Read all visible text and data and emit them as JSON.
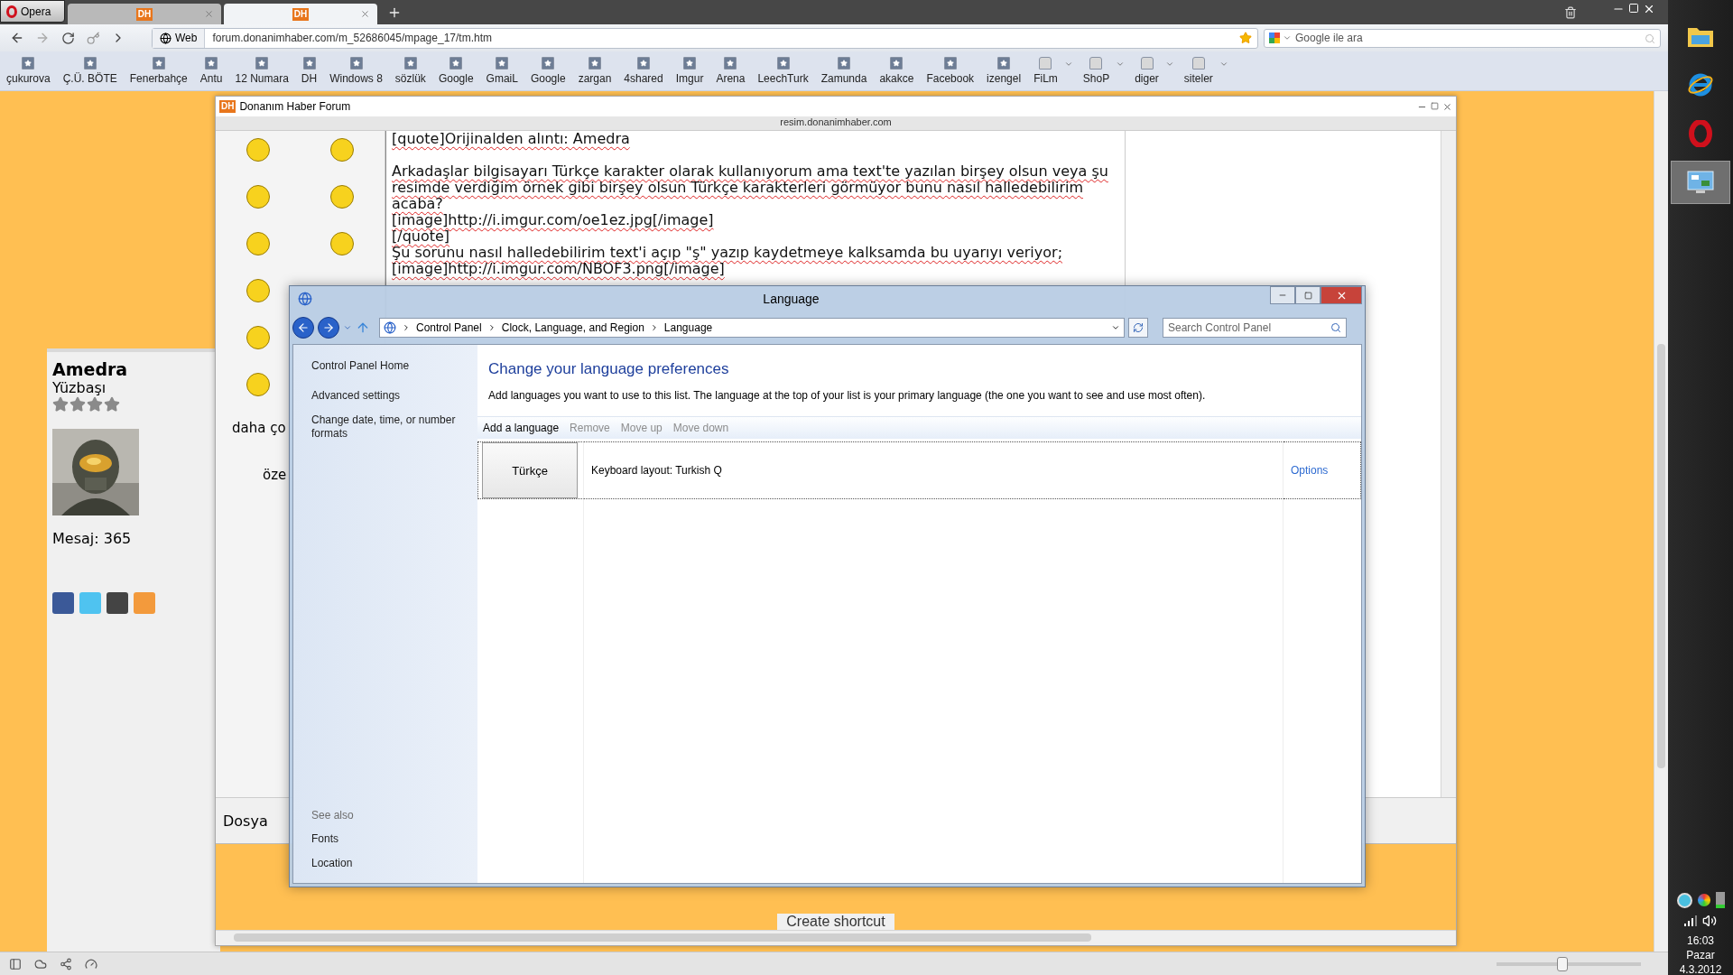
{
  "browser": {
    "menu_button": "Opera",
    "tabs": [
      {
        "logo": "DH",
        "selected": false
      },
      {
        "logo": "DH",
        "selected": true
      }
    ],
    "address": {
      "scheme": "Web",
      "url": "forum.donanimhaber.com/m_52686045/mpage_17/tm.htm"
    },
    "search": {
      "placeholder": "Google ile ara"
    },
    "bookmarks": [
      {
        "label": "çukurova",
        "kind": "site"
      },
      {
        "label": "Ç.Ü. BÖTE",
        "kind": "site"
      },
      {
        "label": "Fenerbahçe",
        "kind": "site"
      },
      {
        "label": "Antu",
        "kind": "site"
      },
      {
        "label": "12 Numara",
        "kind": "site"
      },
      {
        "label": "DH",
        "kind": "site"
      },
      {
        "label": "Windows 8",
        "kind": "site"
      },
      {
        "label": "sözlük",
        "kind": "site"
      },
      {
        "label": "Google",
        "kind": "site"
      },
      {
        "label": "GmaiL",
        "kind": "site"
      },
      {
        "label": "Google",
        "kind": "site"
      },
      {
        "label": "zargan",
        "kind": "site"
      },
      {
        "label": "4shared",
        "kind": "site"
      },
      {
        "label": "Imgur",
        "kind": "site"
      },
      {
        "label": "Arena",
        "kind": "site"
      },
      {
        "label": "LeechTurk",
        "kind": "site"
      },
      {
        "label": "Zamunda",
        "kind": "site"
      },
      {
        "label": "akakce",
        "kind": "site"
      },
      {
        "label": "Facebook",
        "kind": "site"
      },
      {
        "label": "izengel",
        "kind": "site"
      },
      {
        "label": "FiLm",
        "kind": "folder"
      },
      {
        "label": "ShoP",
        "kind": "folder"
      },
      {
        "label": "diger",
        "kind": "folder"
      },
      {
        "label": "siteler",
        "kind": "folder"
      }
    ],
    "zoom_slider": {
      "level": 0.45
    }
  },
  "profile": {
    "name": "Amedra",
    "rank": "Yüzbaşı",
    "stars": 4,
    "message_count": "Mesaj: 365"
  },
  "forum_popup": {
    "logo": "DH",
    "title": "Donanım Haber Forum",
    "host": "resim.donanimhaber.com",
    "editor_lines": [
      "[quote]Orijinalden alıntı:  Amedra",
      "Arkadaşlar bilgisayarı Türkçe karakter olarak kullanıyorum ama text'te yazılan birşey olsun veya şu resimde verdiğim örnek gibi birşey olsun Türkçe karakterleri görmüyor bunu nasıl halledebilirim acaba?",
      "[image]http://i.imgur.com/oe1ez.jpg[/image]",
      "[/quote]",
      "Şu sorunu nasıl halledebilirim text'i açıp \"ş\" yazıp kaydetmeye kalksamda bu uyarıyı veriyor;",
      "[image]http://i.imgur.com/NBOF3.png[/image]"
    ],
    "fragments": [
      "daha ço",
      "öze"
    ],
    "footer_label": "Dosya",
    "menu_item": "Create shortcut"
  },
  "language_window": {
    "title": "Language",
    "breadcrumb": [
      "Control Panel",
      "Clock, Language, and Region",
      "Language"
    ],
    "search": {
      "placeholder": "Search Control Panel"
    },
    "sidebar_links": [
      "Control Panel Home",
      "Advanced settings",
      "Change date, time, or number formats"
    ],
    "see_also": {
      "heading": "See also",
      "links": [
        "Fonts",
        "Location"
      ]
    },
    "heading": "Change your language preferences",
    "description": "Add languages you want to use to this list. The language at the top of your list is your primary language (the one you want to see and use most often).",
    "toolbar": [
      {
        "label": "Add a language",
        "disabled": false
      },
      {
        "label": "Remove",
        "disabled": true
      },
      {
        "label": "Move up",
        "disabled": true
      },
      {
        "label": "Move down",
        "disabled": true
      }
    ],
    "languages": [
      {
        "name": "Türkçe",
        "layout": "Keyboard layout: Turkish Q",
        "options": "Options",
        "selected": true
      }
    ]
  },
  "taskbar": {
    "apps": [
      {
        "kind": "folder",
        "selected": false
      },
      {
        "kind": "ie",
        "selected": false
      },
      {
        "kind": "opera",
        "selected": false
      },
      {
        "kind": "control-panel",
        "selected": true
      }
    ],
    "clock": {
      "time": "16:03",
      "day": "Pazar",
      "date": "4.3.2012"
    }
  }
}
